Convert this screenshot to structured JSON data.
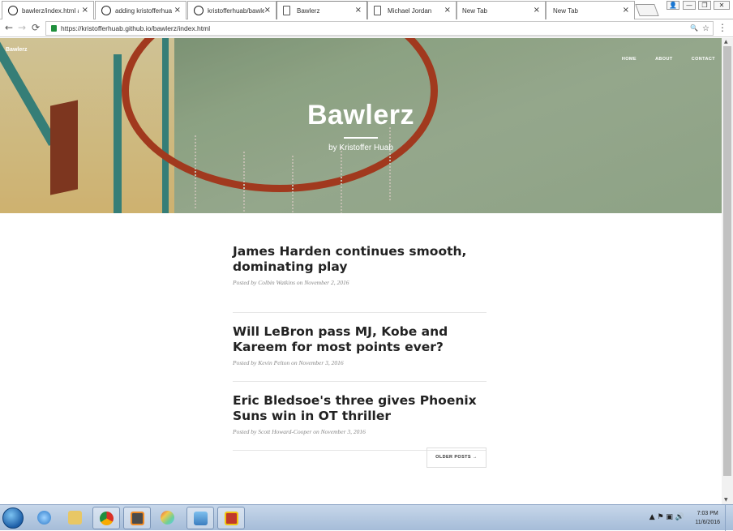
{
  "browser": {
    "tabs": [
      {
        "label": "bawlerz/index.html at",
        "icon": "github-icon"
      },
      {
        "label": "adding kristofferhuab",
        "icon": "github-icon"
      },
      {
        "label": "kristofferhuab/bawler",
        "icon": "github-icon"
      },
      {
        "label": "Bawlerz",
        "icon": "page-icon",
        "active": true
      },
      {
        "label": "Michael Jordan",
        "icon": "page-icon"
      },
      {
        "label": "New Tab",
        "icon": "page-icon"
      },
      {
        "label": "New Tab",
        "icon": "page-icon"
      }
    ],
    "tab_close_glyph": "×",
    "window_buttons": {
      "user": "👤",
      "minimize": "—",
      "maximize": "❐",
      "close": "✕"
    },
    "nav": {
      "back": "←",
      "forward": "→",
      "reload": "⟳"
    },
    "url": "https://kristofferhuab.github.io/bawlerz/index.html",
    "omnibox_icons": {
      "zoom": "🔍",
      "star": "☆",
      "menu": "⋮"
    }
  },
  "site": {
    "brand": "Bawlerz",
    "nav": [
      "HOME",
      "ABOUT",
      "CONTACT"
    ],
    "hero_title": "Bawlerz",
    "hero_subtitle": "by Kristoffer Huab"
  },
  "posts": [
    {
      "title": "James Harden continues smooth, dominating play",
      "meta": "Posted by Colbin Watkins on November 2, 2016"
    },
    {
      "title": "Will LeBron pass MJ, Kobe and Kareem for most points ever?",
      "meta": "Posted by Kevin Pelton on November 3, 2016"
    },
    {
      "title": "Eric Bledsoe's three gives Phoenix Suns win in OT thriller",
      "meta": "Posted by Scott Howard-Cooper on November 3, 2016"
    }
  ],
  "pager": {
    "older": "OLDER POSTS →"
  },
  "scrollbar": {
    "up": "▲",
    "down": "▼"
  },
  "taskbar": {
    "items": [
      "internet-explorer-icon",
      "folder-icon",
      "chrome-icon",
      "sublime-icon",
      "paint-icon",
      "image-viewer-icon",
      "app-icon"
    ],
    "tray": "▲ ⚑ ▣ 🔊",
    "time": "7:03 PM",
    "date": "11/6/2016"
  }
}
